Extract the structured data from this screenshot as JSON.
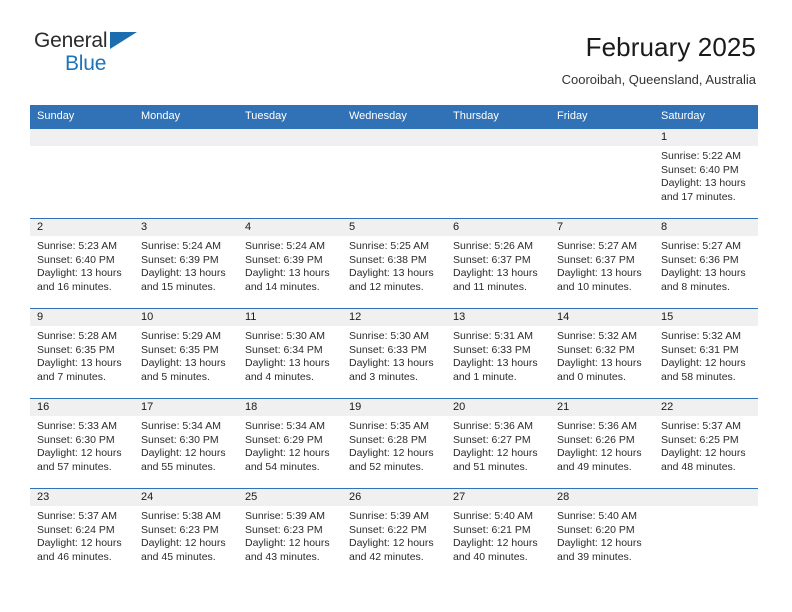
{
  "brand": {
    "name_part1": "General",
    "name_part2": "Blue",
    "flag_icon": "brand-flag-icon",
    "accent_color": "#1e74bb"
  },
  "header": {
    "title": "February 2025",
    "subtitle": "Cooroibah, Queensland, Australia"
  },
  "theme": {
    "header_bar_color": "#3171b5",
    "daynum_band_color": "#f0f0f0",
    "text_color": "#2b2b2b"
  },
  "weekdays": [
    "Sunday",
    "Monday",
    "Tuesday",
    "Wednesday",
    "Thursday",
    "Friday",
    "Saturday"
  ],
  "weeks": [
    {
      "days": [
        {
          "num": "",
          "empty": true,
          "lines": []
        },
        {
          "num": "",
          "empty": true,
          "lines": []
        },
        {
          "num": "",
          "empty": true,
          "lines": []
        },
        {
          "num": "",
          "empty": true,
          "lines": []
        },
        {
          "num": "",
          "empty": true,
          "lines": []
        },
        {
          "num": "",
          "empty": true,
          "lines": []
        },
        {
          "num": "1",
          "empty": false,
          "lines": [
            "Sunrise: 5:22 AM",
            "Sunset: 6:40 PM",
            "Daylight: 13 hours",
            "and 17 minutes."
          ]
        }
      ]
    },
    {
      "days": [
        {
          "num": "2",
          "empty": false,
          "lines": [
            "Sunrise: 5:23 AM",
            "Sunset: 6:40 PM",
            "Daylight: 13 hours",
            "and 16 minutes."
          ]
        },
        {
          "num": "3",
          "empty": false,
          "lines": [
            "Sunrise: 5:24 AM",
            "Sunset: 6:39 PM",
            "Daylight: 13 hours",
            "and 15 minutes."
          ]
        },
        {
          "num": "4",
          "empty": false,
          "lines": [
            "Sunrise: 5:24 AM",
            "Sunset: 6:39 PM",
            "Daylight: 13 hours",
            "and 14 minutes."
          ]
        },
        {
          "num": "5",
          "empty": false,
          "lines": [
            "Sunrise: 5:25 AM",
            "Sunset: 6:38 PM",
            "Daylight: 13 hours",
            "and 12 minutes."
          ]
        },
        {
          "num": "6",
          "empty": false,
          "lines": [
            "Sunrise: 5:26 AM",
            "Sunset: 6:37 PM",
            "Daylight: 13 hours",
            "and 11 minutes."
          ]
        },
        {
          "num": "7",
          "empty": false,
          "lines": [
            "Sunrise: 5:27 AM",
            "Sunset: 6:37 PM",
            "Daylight: 13 hours",
            "and 10 minutes."
          ]
        },
        {
          "num": "8",
          "empty": false,
          "lines": [
            "Sunrise: 5:27 AM",
            "Sunset: 6:36 PM",
            "Daylight: 13 hours",
            "and 8 minutes."
          ]
        }
      ]
    },
    {
      "days": [
        {
          "num": "9",
          "empty": false,
          "lines": [
            "Sunrise: 5:28 AM",
            "Sunset: 6:35 PM",
            "Daylight: 13 hours",
            "and 7 minutes."
          ]
        },
        {
          "num": "10",
          "empty": false,
          "lines": [
            "Sunrise: 5:29 AM",
            "Sunset: 6:35 PM",
            "Daylight: 13 hours",
            "and 5 minutes."
          ]
        },
        {
          "num": "11",
          "empty": false,
          "lines": [
            "Sunrise: 5:30 AM",
            "Sunset: 6:34 PM",
            "Daylight: 13 hours",
            "and 4 minutes."
          ]
        },
        {
          "num": "12",
          "empty": false,
          "lines": [
            "Sunrise: 5:30 AM",
            "Sunset: 6:33 PM",
            "Daylight: 13 hours",
            "and 3 minutes."
          ]
        },
        {
          "num": "13",
          "empty": false,
          "lines": [
            "Sunrise: 5:31 AM",
            "Sunset: 6:33 PM",
            "Daylight: 13 hours",
            "and 1 minute."
          ]
        },
        {
          "num": "14",
          "empty": false,
          "lines": [
            "Sunrise: 5:32 AM",
            "Sunset: 6:32 PM",
            "Daylight: 13 hours",
            "and 0 minutes."
          ]
        },
        {
          "num": "15",
          "empty": false,
          "lines": [
            "Sunrise: 5:32 AM",
            "Sunset: 6:31 PM",
            "Daylight: 12 hours",
            "and 58 minutes."
          ]
        }
      ]
    },
    {
      "days": [
        {
          "num": "16",
          "empty": false,
          "lines": [
            "Sunrise: 5:33 AM",
            "Sunset: 6:30 PM",
            "Daylight: 12 hours",
            "and 57 minutes."
          ]
        },
        {
          "num": "17",
          "empty": false,
          "lines": [
            "Sunrise: 5:34 AM",
            "Sunset: 6:30 PM",
            "Daylight: 12 hours",
            "and 55 minutes."
          ]
        },
        {
          "num": "18",
          "empty": false,
          "lines": [
            "Sunrise: 5:34 AM",
            "Sunset: 6:29 PM",
            "Daylight: 12 hours",
            "and 54 minutes."
          ]
        },
        {
          "num": "19",
          "empty": false,
          "lines": [
            "Sunrise: 5:35 AM",
            "Sunset: 6:28 PM",
            "Daylight: 12 hours",
            "and 52 minutes."
          ]
        },
        {
          "num": "20",
          "empty": false,
          "lines": [
            "Sunrise: 5:36 AM",
            "Sunset: 6:27 PM",
            "Daylight: 12 hours",
            "and 51 minutes."
          ]
        },
        {
          "num": "21",
          "empty": false,
          "lines": [
            "Sunrise: 5:36 AM",
            "Sunset: 6:26 PM",
            "Daylight: 12 hours",
            "and 49 minutes."
          ]
        },
        {
          "num": "22",
          "empty": false,
          "lines": [
            "Sunrise: 5:37 AM",
            "Sunset: 6:25 PM",
            "Daylight: 12 hours",
            "and 48 minutes."
          ]
        }
      ]
    },
    {
      "days": [
        {
          "num": "23",
          "empty": false,
          "lines": [
            "Sunrise: 5:37 AM",
            "Sunset: 6:24 PM",
            "Daylight: 12 hours",
            "and 46 minutes."
          ]
        },
        {
          "num": "24",
          "empty": false,
          "lines": [
            "Sunrise: 5:38 AM",
            "Sunset: 6:23 PM",
            "Daylight: 12 hours",
            "and 45 minutes."
          ]
        },
        {
          "num": "25",
          "empty": false,
          "lines": [
            "Sunrise: 5:39 AM",
            "Sunset: 6:23 PM",
            "Daylight: 12 hours",
            "and 43 minutes."
          ]
        },
        {
          "num": "26",
          "empty": false,
          "lines": [
            "Sunrise: 5:39 AM",
            "Sunset: 6:22 PM",
            "Daylight: 12 hours",
            "and 42 minutes."
          ]
        },
        {
          "num": "27",
          "empty": false,
          "lines": [
            "Sunrise: 5:40 AM",
            "Sunset: 6:21 PM",
            "Daylight: 12 hours",
            "and 40 minutes."
          ]
        },
        {
          "num": "28",
          "empty": false,
          "lines": [
            "Sunrise: 5:40 AM",
            "Sunset: 6:20 PM",
            "Daylight: 12 hours",
            "and 39 minutes."
          ]
        },
        {
          "num": "",
          "empty": true,
          "lines": []
        }
      ]
    }
  ]
}
